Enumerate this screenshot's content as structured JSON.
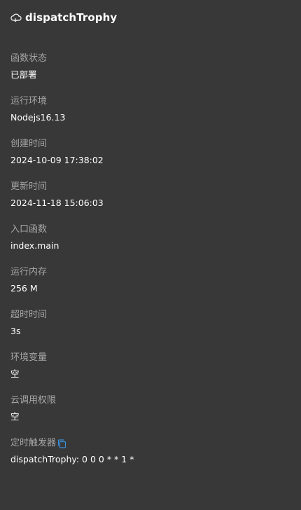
{
  "header": {
    "icon": "cloud-icon",
    "title": "dispatchTrophy"
  },
  "fields": [
    {
      "label": "函数状态",
      "value": "已部署"
    },
    {
      "label": "运行环境",
      "value": "Nodejs16.13"
    },
    {
      "label": "创建时间",
      "value": "2024-10-09 17:38:02"
    },
    {
      "label": "更新时间",
      "value": "2024-11-18 15:06:03"
    },
    {
      "label": "入口函数",
      "value": "index.main"
    },
    {
      "label": "运行内存",
      "value": "256 M"
    },
    {
      "label": "超时时间",
      "value": "3s"
    },
    {
      "label": "环境变量",
      "value": "空"
    },
    {
      "label": "云调用权限",
      "value": "空"
    },
    {
      "label": "定时触发器",
      "value": "dispatchTrophy: 0 0 0 * * 1 *",
      "icon": "copy-icon"
    }
  ],
  "colors": {
    "background": "#383838",
    "label": "#a6a6a6",
    "value": "#ffffff",
    "accent": "#3b8fd6"
  }
}
